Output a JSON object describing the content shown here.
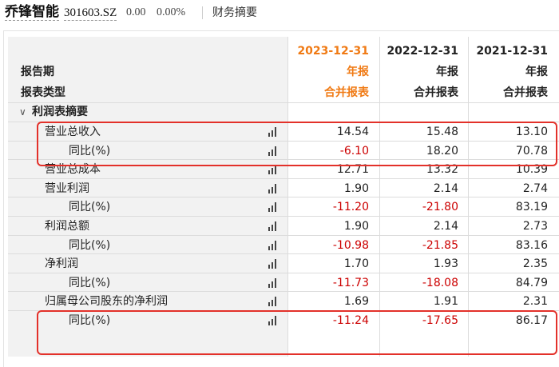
{
  "header": {
    "stock_name": "乔锋智能",
    "stock_code": "301603.SZ",
    "price": "0.00",
    "change_pct": "0.00%",
    "page_title": "财务摘要"
  },
  "table": {
    "periods": [
      {
        "date": "2023-12-31",
        "report": "年报",
        "type": "合并报表"
      },
      {
        "date": "2022-12-31",
        "report": "年报",
        "type": "合并报表"
      },
      {
        "date": "2021-12-31",
        "report": "年报",
        "type": "合并报表"
      }
    ],
    "row_labels": {
      "period": "报告期",
      "report_type": "报表类型"
    },
    "section_title": "利润表摘要",
    "rows": [
      {
        "label": "营业总收入",
        "values": [
          "14.54",
          "15.48",
          "13.10"
        ]
      },
      {
        "label": "同比(%)",
        "values": [
          "-6.10",
          "18.20",
          "70.78"
        ]
      },
      {
        "label": "营业总成本",
        "values": [
          "12.71",
          "13.32",
          "10.39"
        ]
      },
      {
        "label": "营业利润",
        "values": [
          "1.90",
          "2.14",
          "2.74"
        ]
      },
      {
        "label": "同比(%)",
        "values": [
          "-11.20",
          "-21.80",
          "83.19"
        ]
      },
      {
        "label": "利润总额",
        "values": [
          "1.90",
          "2.14",
          "2.73"
        ]
      },
      {
        "label": "同比(%)",
        "values": [
          "-10.98",
          "-21.85",
          "83.16"
        ]
      },
      {
        "label": "净利润",
        "values": [
          "1.70",
          "1.93",
          "2.35"
        ]
      },
      {
        "label": "同比(%)",
        "values": [
          "-11.73",
          "-18.08",
          "84.79"
        ]
      },
      {
        "label": "归属母公司股东的净利润",
        "values": [
          "1.69",
          "1.91",
          "2.31"
        ]
      },
      {
        "label": "同比(%)",
        "values": [
          "-11.24",
          "-17.65",
          "86.17"
        ]
      }
    ]
  },
  "colors": {
    "accent_orange": "#f07a14",
    "negative_red": "#cc0000",
    "highlight_red": "#e3312a"
  }
}
